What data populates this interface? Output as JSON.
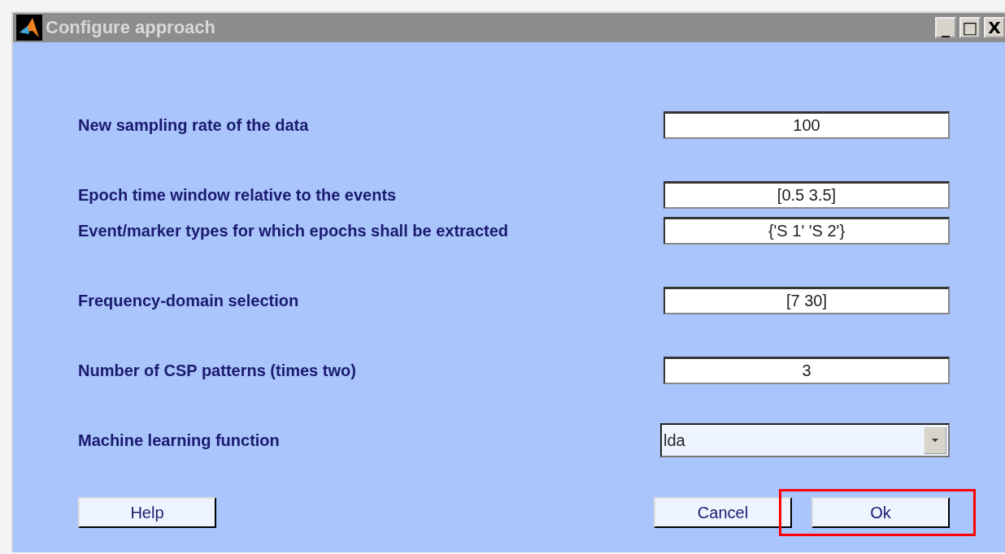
{
  "window": {
    "title": "Configure approach",
    "controls": [
      "_",
      "□",
      "X"
    ]
  },
  "sections": [
    [
      {
        "label": "New sampling rate of the data",
        "kind": "field",
        "value": "100"
      }
    ],
    [
      {
        "label": "Epoch time window relative to the events",
        "kind": "field",
        "value": "[0.5 3.5]"
      },
      {
        "label": "Event/marker types for which epochs shall be extracted",
        "kind": "field",
        "value": "{'S  1' 'S  2'}"
      }
    ],
    [
      {
        "label": "Frequency-domain selection",
        "kind": "field",
        "value": "[7 30]"
      }
    ],
    [
      {
        "label": "Number of CSP patterns (times two)",
        "kind": "field",
        "value": "3"
      }
    ],
    [
      {
        "label": "Machine learning function",
        "kind": "dropdown",
        "value": "lda"
      }
    ]
  ],
  "buttons": [
    {
      "label": "Help"
    },
    {
      "label": "Cancel"
    },
    {
      "label": "Ok",
      "highlighted": true
    }
  ]
}
